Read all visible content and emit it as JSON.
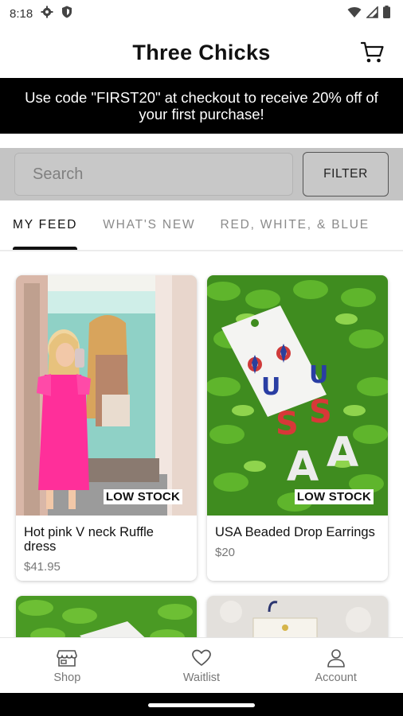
{
  "status_bar": {
    "time": "8:18"
  },
  "header": {
    "title": "Three Chicks"
  },
  "promo": {
    "text": "Use code \"FIRST20\" at checkout to receive 20% off of your first purchase!"
  },
  "search": {
    "placeholder": "Search",
    "filter_label": "FILTER"
  },
  "tabs": [
    {
      "label": "MY FEED",
      "active": true
    },
    {
      "label": "WHAT'S NEW",
      "active": false
    },
    {
      "label": "RED, WHITE, & BLUE",
      "active": false
    }
  ],
  "products": [
    {
      "name": "Hot pink V neck Ruffle dress",
      "price": "$41.95",
      "badge": "LOW STOCK"
    },
    {
      "name": "USA Beaded Drop Earrings",
      "price": "$20",
      "badge": "LOW STOCK"
    }
  ],
  "bottom_nav": [
    {
      "label": "Shop",
      "icon": "storefront-icon"
    },
    {
      "label": "Waitlist",
      "icon": "heart-icon"
    },
    {
      "label": "Account",
      "icon": "person-icon"
    }
  ]
}
